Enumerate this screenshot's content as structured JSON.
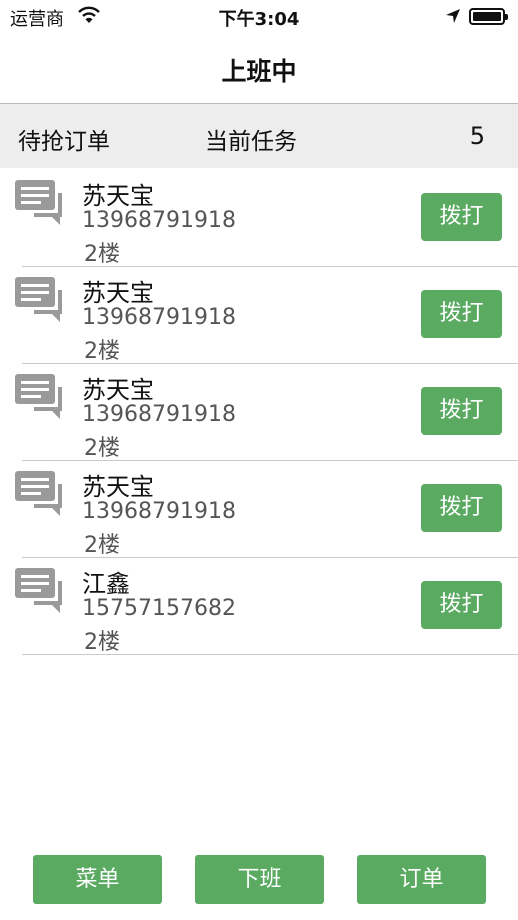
{
  "status_bar": {
    "carrier": "运营商",
    "time": "下午3:04",
    "icons": [
      "wifi-icon",
      "location-arrow-icon",
      "battery-icon"
    ]
  },
  "nav": {
    "title": "上班中"
  },
  "summary": {
    "pending_label": "待抢订单",
    "current_label": "当前任务",
    "count": "5"
  },
  "orders": [
    {
      "name": "苏天宝",
      "phone": "13968791918",
      "floor": "2楼",
      "call_label": "拨打",
      "icon": "message-icon"
    },
    {
      "name": "苏天宝",
      "phone": "13968791918",
      "floor": "2楼",
      "call_label": "拨打",
      "icon": "message-icon"
    },
    {
      "name": "苏天宝",
      "phone": "13968791918",
      "floor": "2楼",
      "call_label": "拨打",
      "icon": "message-icon"
    },
    {
      "name": "苏天宝",
      "phone": "13968791918",
      "floor": "2楼",
      "call_label": "拨打",
      "icon": "message-icon"
    },
    {
      "name": "江鑫",
      "phone": "15757157682",
      "floor": "2楼",
      "call_label": "拨打",
      "icon": "message-icon"
    }
  ],
  "bottom": {
    "menu_label": "菜单",
    "offwork_label": "下班",
    "orders_label": "订单"
  },
  "colors": {
    "accent": "#5aaa62",
    "summary_bg": "#ededed",
    "icon_gray": "#9a9a9a"
  }
}
